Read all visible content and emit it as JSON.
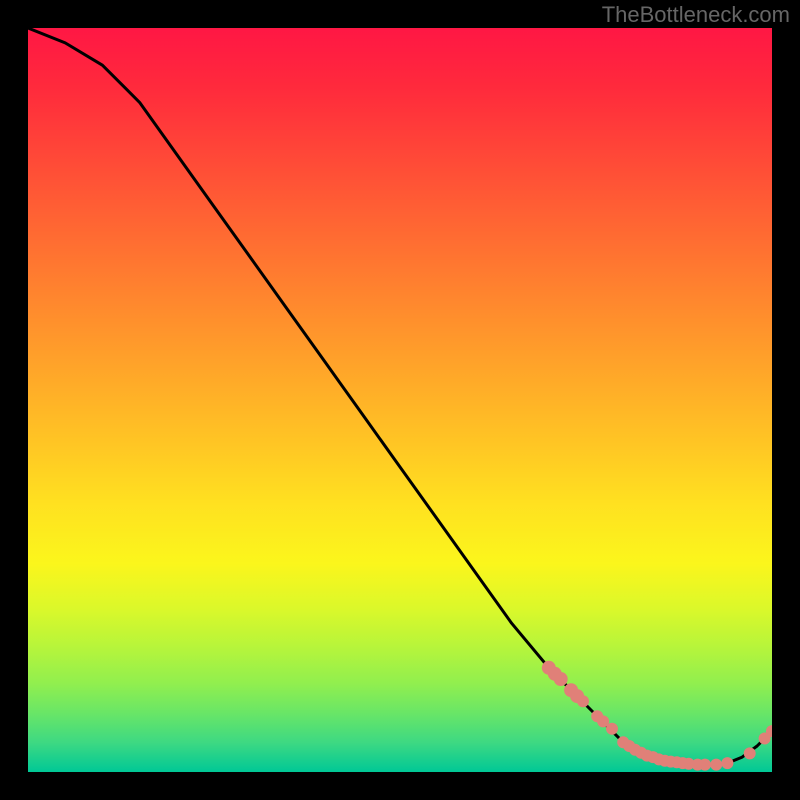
{
  "watermark": "TheBottleneck.com",
  "chart_data": {
    "type": "line",
    "title": "",
    "xlabel": "",
    "ylabel": "",
    "xlim": [
      0,
      100
    ],
    "ylim": [
      0,
      100
    ],
    "grid": false,
    "legend": false,
    "series": [
      {
        "name": "curve",
        "x": [
          0,
          5,
          10,
          15,
          20,
          25,
          30,
          35,
          40,
          45,
          50,
          55,
          60,
          65,
          70,
          72,
          75,
          78,
          80,
          82,
          84,
          86,
          88,
          90,
          92,
          94,
          96,
          98,
          100
        ],
        "y": [
          100,
          98,
          95,
          90,
          83,
          76,
          69,
          62,
          55,
          48,
          41,
          34,
          27,
          20,
          14,
          12,
          9,
          6,
          4,
          3,
          2,
          1.5,
          1.2,
          1.0,
          1.0,
          1.2,
          2.0,
          3.5,
          5.5
        ]
      }
    ],
    "markers": [
      {
        "x": 70.0,
        "y": 14.0,
        "r": 7
      },
      {
        "x": 70.8,
        "y": 13.2,
        "r": 7
      },
      {
        "x": 71.6,
        "y": 12.5,
        "r": 7
      },
      {
        "x": 73.0,
        "y": 11.0,
        "r": 7
      },
      {
        "x": 73.8,
        "y": 10.2,
        "r": 7
      },
      {
        "x": 74.6,
        "y": 9.5,
        "r": 6
      },
      {
        "x": 76.5,
        "y": 7.5,
        "r": 6
      },
      {
        "x": 77.3,
        "y": 6.8,
        "r": 6
      },
      {
        "x": 78.5,
        "y": 5.8,
        "r": 6
      },
      {
        "x": 80.0,
        "y": 4.0,
        "r": 6
      },
      {
        "x": 80.8,
        "y": 3.5,
        "r": 6
      },
      {
        "x": 81.6,
        "y": 3.0,
        "r": 6
      },
      {
        "x": 82.4,
        "y": 2.6,
        "r": 6
      },
      {
        "x": 83.2,
        "y": 2.2,
        "r": 6
      },
      {
        "x": 84.0,
        "y": 2.0,
        "r": 6
      },
      {
        "x": 84.8,
        "y": 1.7,
        "r": 6
      },
      {
        "x": 85.6,
        "y": 1.5,
        "r": 6
      },
      {
        "x": 86.4,
        "y": 1.4,
        "r": 6
      },
      {
        "x": 87.2,
        "y": 1.3,
        "r": 6
      },
      {
        "x": 88.0,
        "y": 1.2,
        "r": 6
      },
      {
        "x": 88.8,
        "y": 1.1,
        "r": 6
      },
      {
        "x": 90.0,
        "y": 1.0,
        "r": 6
      },
      {
        "x": 91.0,
        "y": 1.0,
        "r": 6
      },
      {
        "x": 92.5,
        "y": 1.0,
        "r": 6
      },
      {
        "x": 94.0,
        "y": 1.2,
        "r": 6
      },
      {
        "x": 97.0,
        "y": 2.5,
        "r": 6
      },
      {
        "x": 99.0,
        "y": 4.5,
        "r": 6
      },
      {
        "x": 100.0,
        "y": 5.5,
        "r": 6
      }
    ],
    "colors": {
      "curve_stroke": "#000000",
      "marker_fill": "#e08078",
      "gradient_top": "#ff1744",
      "gradient_bottom": "#00c896"
    }
  }
}
